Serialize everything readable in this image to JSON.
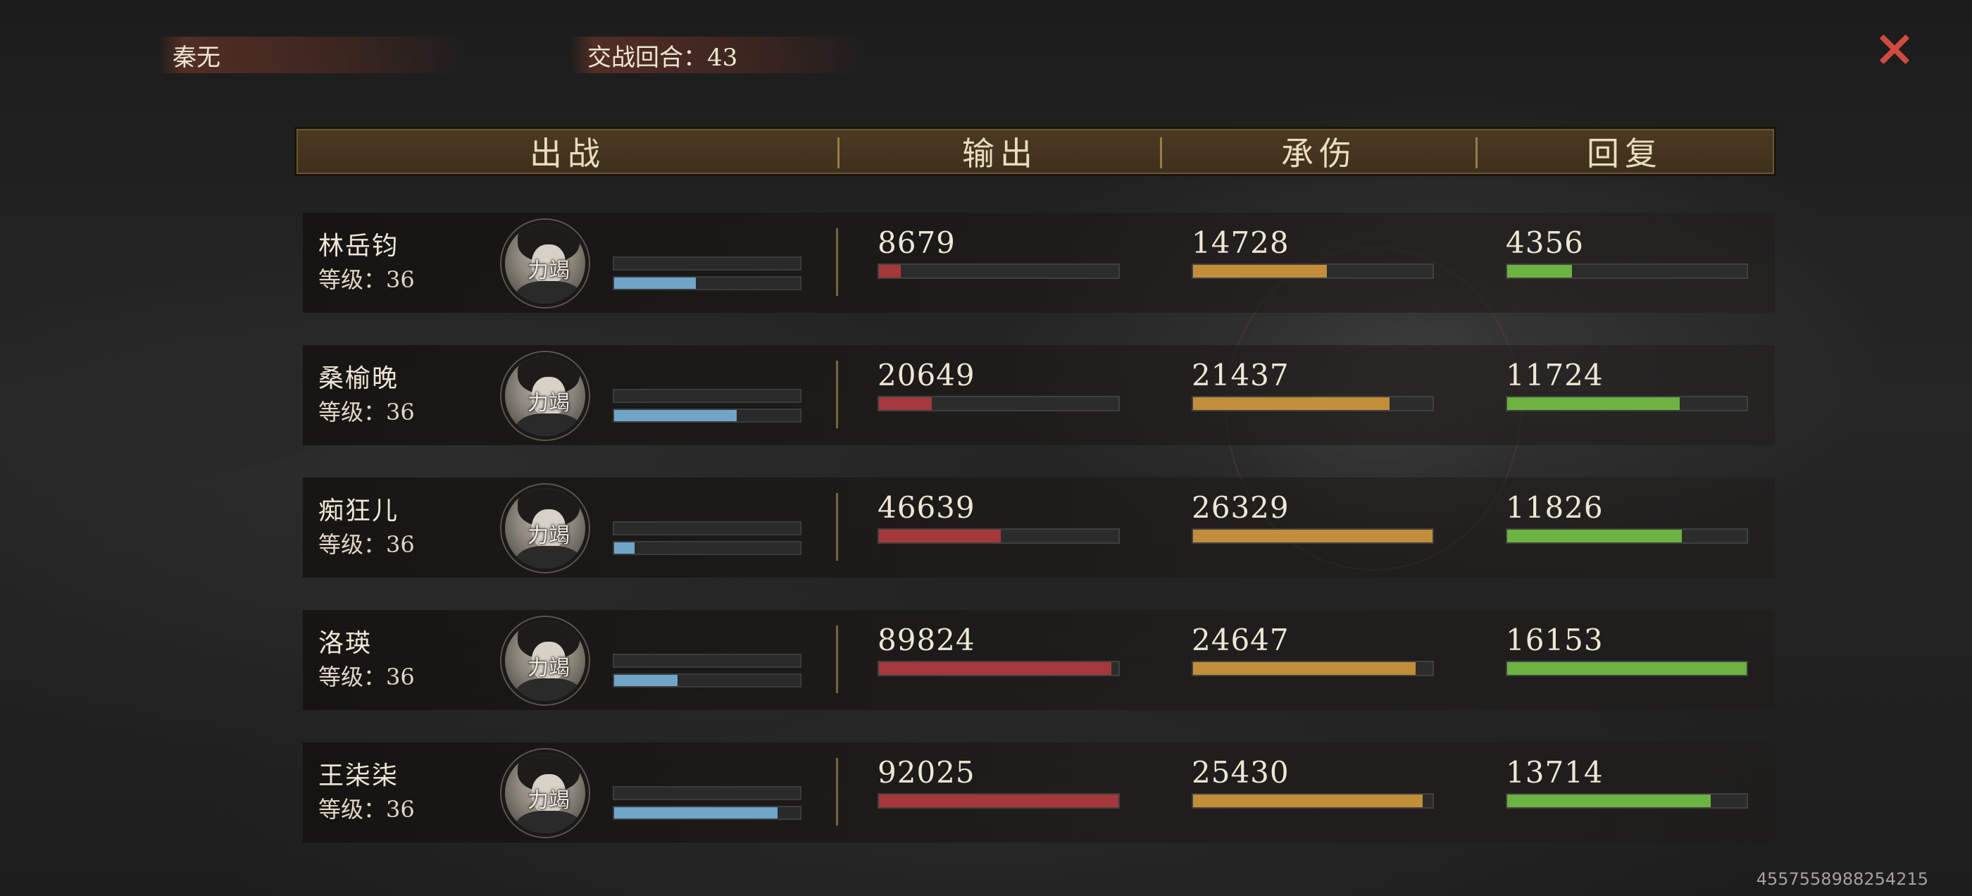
{
  "top": {
    "player_name": "秦无",
    "round_label": "交战回合：43"
  },
  "header": {
    "col_fighter": "出战",
    "col_output": "输出",
    "col_damage_taken": "承伤",
    "col_healing": "回复"
  },
  "avatar_stamp": "力竭",
  "colors": {
    "output_bar": "#a5383a",
    "damage_taken_bar": "#c28e3a",
    "healing_bar": "#6cb342",
    "hp_bar": "#6fa6c8",
    "close_icon": "#d04a3e"
  },
  "rows": [
    {
      "name": "林岳钧",
      "level": "等级：36",
      "hp_fraction": 0.44,
      "output": "8679",
      "output_fraction": 0.09,
      "taken": "14728",
      "taken_fraction": 0.56,
      "heal": "4356",
      "heal_fraction": 0.27
    },
    {
      "name": "桑榆晚",
      "level": "等级：36",
      "hp_fraction": 0.66,
      "output": "20649",
      "output_fraction": 0.22,
      "taken": "21437",
      "taken_fraction": 0.82,
      "heal": "11724",
      "heal_fraction": 0.72
    },
    {
      "name": "痴狂儿",
      "level": "等级：36",
      "hp_fraction": 0.11,
      "output": "46639",
      "output_fraction": 0.51,
      "taken": "26329",
      "taken_fraction": 1.0,
      "heal": "11826",
      "heal_fraction": 0.73
    },
    {
      "name": "洛瑛",
      "level": "等级：36",
      "hp_fraction": 0.34,
      "output": "89824",
      "output_fraction": 0.97,
      "taken": "24647",
      "taken_fraction": 0.93,
      "heal": "16153",
      "heal_fraction": 1.0
    },
    {
      "name": "王柒柒",
      "level": "等级：36",
      "hp_fraction": 0.88,
      "output": "92025",
      "output_fraction": 1.0,
      "taken": "25430",
      "taken_fraction": 0.96,
      "heal": "13714",
      "heal_fraction": 0.85
    }
  ],
  "footer_id": "4557558988254215"
}
